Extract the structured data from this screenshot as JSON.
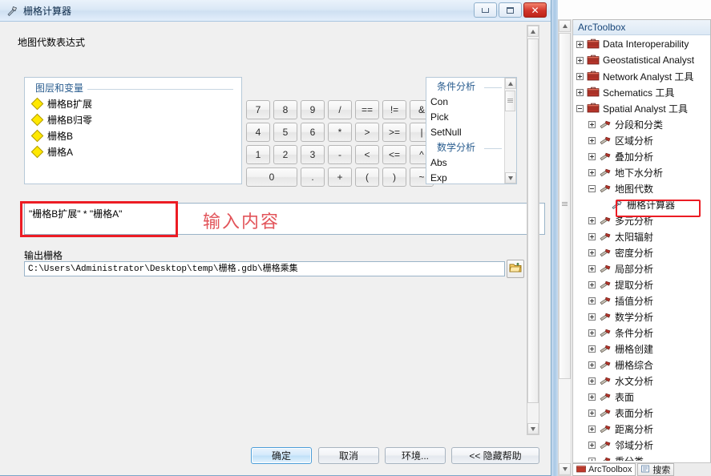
{
  "dialog": {
    "title": "栅格计算器",
    "title_icon": "hammer-tool-icon",
    "window_buttons": {
      "minimize": "–",
      "maximize": "□",
      "close": "✕"
    },
    "section_title": "地图代数表达式",
    "layers": {
      "group_title": "图层和变量",
      "items": [
        {
          "label": "栅格B扩展",
          "icon": "raster-layer-icon"
        },
        {
          "label": "栅格B归零",
          "icon": "raster-layer-icon"
        },
        {
          "label": "栅格B",
          "icon": "raster-layer-icon"
        },
        {
          "label": "栅格A",
          "icon": "raster-layer-icon"
        }
      ]
    },
    "keypad": {
      "rows": [
        [
          "7",
          "8",
          "9",
          "/",
          "==",
          "!=",
          "&"
        ],
        [
          "4",
          "5",
          "6",
          "*",
          ">",
          ">=",
          "|"
        ],
        [
          "1",
          "2",
          "3",
          "-",
          "<",
          "<=",
          "^"
        ],
        [
          "0",
          ".",
          "+",
          "(",
          ")",
          "~"
        ]
      ]
    },
    "tools": {
      "groups": [
        {
          "title": "条件分析",
          "items": [
            "Con",
            "Pick",
            "SetNull"
          ]
        },
        {
          "title": "数学分析",
          "items": [
            "Abs",
            "Exp"
          ]
        }
      ]
    },
    "expression": {
      "value": "\"栅格B扩展\" * \"栅格A\"",
      "annotation": "输入内容"
    },
    "output": {
      "label": "输出栅格",
      "value": "C:\\Users\\Administrator\\Desktop\\temp\\栅格.gdb\\栅格乘集",
      "browse_icon": "open-folder-icon"
    },
    "buttons": {
      "ok": "确定",
      "cancel": "取消",
      "environments": "环境...",
      "hide_help": "<< 隐藏帮助"
    }
  },
  "toolbox": {
    "header": "ArcToolbox",
    "tree": [
      {
        "label": "Data Interoperability 工具",
        "display": "Data Interoperability",
        "level": 0,
        "expander": "plus",
        "icon": "toolbox-icon"
      },
      {
        "label": "Geostatistical Analyst 工具",
        "display": "Geostatistical Analyst",
        "level": 0,
        "expander": "plus",
        "icon": "toolbox-icon"
      },
      {
        "label": "Network Analyst 工具",
        "display": "Network Analyst 工具",
        "level": 0,
        "expander": "plus",
        "icon": "toolbox-icon"
      },
      {
        "label": "Schematics 工具",
        "display": "Schematics 工具",
        "level": 0,
        "expander": "plus",
        "icon": "toolbox-icon"
      },
      {
        "label": "Spatial Analyst 工具",
        "display": "Spatial Analyst 工具",
        "level": 0,
        "expander": "minus",
        "icon": "toolbox-icon"
      },
      {
        "label": "分段和分类",
        "display": "分段和分类",
        "level": 1,
        "expander": "plus",
        "icon": "toolset-icon"
      },
      {
        "label": "区域分析",
        "display": "区域分析",
        "level": 1,
        "expander": "plus",
        "icon": "toolset-icon"
      },
      {
        "label": "叠加分析",
        "display": "叠加分析",
        "level": 1,
        "expander": "plus",
        "icon": "toolset-icon"
      },
      {
        "label": "地下水分析",
        "display": "地下水分析",
        "level": 1,
        "expander": "plus",
        "icon": "toolset-icon"
      },
      {
        "label": "地图代数",
        "display": "地图代数",
        "level": 1,
        "expander": "minus",
        "icon": "toolset-icon"
      },
      {
        "label": "栅格计算器",
        "display": "栅格计算器",
        "level": 2,
        "expander": "none",
        "icon": "hammer-tool-icon",
        "highlighted": true
      },
      {
        "label": "多元分析",
        "display": "多元分析",
        "level": 1,
        "expander": "plus",
        "icon": "toolset-icon"
      },
      {
        "label": "太阳辐射",
        "display": "太阳辐射",
        "level": 1,
        "expander": "plus",
        "icon": "toolset-icon"
      },
      {
        "label": "密度分析",
        "display": "密度分析",
        "level": 1,
        "expander": "plus",
        "icon": "toolset-icon"
      },
      {
        "label": "局部分析",
        "display": "局部分析",
        "level": 1,
        "expander": "plus",
        "icon": "toolset-icon"
      },
      {
        "label": "提取分析",
        "display": "提取分析",
        "level": 1,
        "expander": "plus",
        "icon": "toolset-icon"
      },
      {
        "label": "插值分析",
        "display": "插值分析",
        "level": 1,
        "expander": "plus",
        "icon": "toolset-icon"
      },
      {
        "label": "数学分析",
        "display": "数学分析",
        "level": 1,
        "expander": "plus",
        "icon": "toolset-icon"
      },
      {
        "label": "条件分析",
        "display": "条件分析",
        "level": 1,
        "expander": "plus",
        "icon": "toolset-icon"
      },
      {
        "label": "栅格创建",
        "display": "栅格创建",
        "level": 1,
        "expander": "plus",
        "icon": "toolset-icon"
      },
      {
        "label": "栅格综合",
        "display": "栅格综合",
        "level": 1,
        "expander": "plus",
        "icon": "toolset-icon"
      },
      {
        "label": "水文分析",
        "display": "水文分析",
        "level": 1,
        "expander": "plus",
        "icon": "toolset-icon"
      },
      {
        "label": "表面",
        "display": "表面",
        "level": 1,
        "expander": "plus",
        "icon": "toolset-icon"
      },
      {
        "label": "表面分析",
        "display": "表面分析",
        "level": 1,
        "expander": "plus",
        "icon": "toolset-icon"
      },
      {
        "label": "距离分析",
        "display": "距离分析",
        "level": 1,
        "expander": "plus",
        "icon": "toolset-icon"
      },
      {
        "label": "邻域分析",
        "display": "邻域分析",
        "level": 1,
        "expander": "plus",
        "icon": "toolset-icon"
      },
      {
        "label": "重分类",
        "display": "重分类",
        "level": 1,
        "expander": "plus",
        "icon": "toolset-icon"
      }
    ],
    "tabs": [
      {
        "label": "ArcToolbox",
        "icon": "toolbox-icon",
        "active": true
      },
      {
        "label": "搜索",
        "icon": "search-icon",
        "active": false
      }
    ]
  },
  "colors": {
    "red_highlight": "#ec1c24",
    "annotation_red": "#e2545a",
    "layer_yellow": "#ffe800",
    "accent_blue": "#2a5d8f"
  }
}
